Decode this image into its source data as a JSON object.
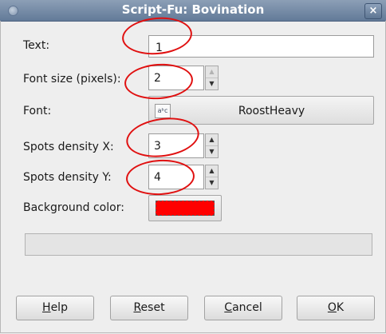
{
  "window": {
    "title": "Script-Fu: Bovination",
    "close_glyph": "×"
  },
  "form": {
    "text": {
      "label": "Text:",
      "value": "1"
    },
    "font_size": {
      "label": "Font size (pixels):",
      "value": "2"
    },
    "font": {
      "label": "Font:",
      "value": "RoostHeavy",
      "icon_glyph": "aᵇc"
    },
    "spots_x": {
      "label": "Spots density X:",
      "value": "3"
    },
    "spots_y": {
      "label": "Spots density Y:",
      "value": "4"
    },
    "background": {
      "label": "Background color:",
      "color": "#ff0000"
    }
  },
  "buttons": {
    "help": {
      "accel": "H",
      "rest": "elp"
    },
    "reset": {
      "accel": "R",
      "rest": "eset"
    },
    "cancel": {
      "accel": "C",
      "rest": "ancel"
    },
    "ok": {
      "accel": "O",
      "rest": "K"
    }
  },
  "colors": {
    "annotation": "#e01010",
    "titlebar": "#6f86a4"
  }
}
